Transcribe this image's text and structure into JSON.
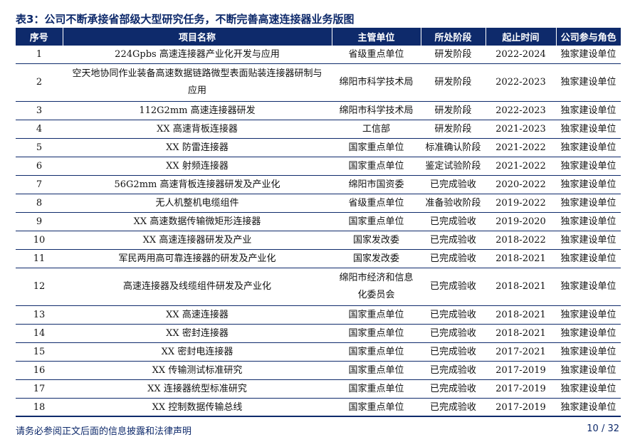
{
  "table_title": "表3：公司不断承接省部级大型研究任务，不断完善高速连接器业务版图",
  "columns": [
    "序号",
    "项目名称",
    "主管单位",
    "所处阶段",
    "起止时间",
    "公司参与角色"
  ],
  "rows": [
    {
      "no": "1",
      "name": "224Gpbs 高速连接器产业化开发与应用",
      "unit": "省级重点单位",
      "stage": "研发阶段",
      "period": "2022-2024",
      "role": "独家建设单位"
    },
    {
      "no": "2",
      "name": "空天地协同作业装备高速数据链路微型表面贴装连接器研制与应用",
      "unit": "绵阳市科学技术局",
      "stage": "研发阶段",
      "period": "2022-2023",
      "role": "独家建设单位"
    },
    {
      "no": "3",
      "name": "112G2mm 高速连接器研发",
      "unit": "绵阳市科学技术局",
      "stage": "研发阶段",
      "period": "2022-2023",
      "role": "独家建设单位"
    },
    {
      "no": "4",
      "name": "XX 高速背板连接器",
      "unit": "工信部",
      "stage": "研发阶段",
      "period": "2021-2023",
      "role": "独家建设单位"
    },
    {
      "no": "5",
      "name": "XX 防雷连接器",
      "unit": "国家重点单位",
      "stage": "标准确认阶段",
      "period": "2021-2022",
      "role": "独家建设单位"
    },
    {
      "no": "6",
      "name": "XX 射频连接器",
      "unit": "国家重点单位",
      "stage": "鉴定试验阶段",
      "period": "2021-2022",
      "role": "独家建设单位"
    },
    {
      "no": "7",
      "name": "56G2mm 高速背板连接器研发及产业化",
      "unit": "绵阳市国资委",
      "stage": "已完成验收",
      "period": "2020-2022",
      "role": "独家建设单位"
    },
    {
      "no": "8",
      "name": "无人机整机电缆组件",
      "unit": "省级重点单位",
      "stage": "准备验收阶段",
      "period": "2019-2022",
      "role": "独家建设单位"
    },
    {
      "no": "9",
      "name": "XX 高速数据传输微矩形连接器",
      "unit": "国家重点单位",
      "stage": "已完成验收",
      "period": "2019-2020",
      "role": "独家建设单位"
    },
    {
      "no": "10",
      "name": "XX 高速连接器研发及产业",
      "unit": "国家发改委",
      "stage": "已完成验收",
      "period": "2018-2022",
      "role": "独家建设单位"
    },
    {
      "no": "11",
      "name": "军民两用高可靠连接器的研发及产业化",
      "unit": "国家发改委",
      "stage": "已完成验收",
      "period": "2018-2021",
      "role": "独家建设单位"
    },
    {
      "no": "12",
      "name": "高速连接器及线缆组件研发及产业化",
      "unit": "绵阳市经济和信息化委员会",
      "stage": "已完成验收",
      "period": "2018-2021",
      "role": "独家建设单位"
    },
    {
      "no": "13",
      "name": "XX 高速连接器",
      "unit": "国家重点单位",
      "stage": "已完成验收",
      "period": "2018-2021",
      "role": "独家建设单位"
    },
    {
      "no": "14",
      "name": "XX 密封连接器",
      "unit": "国家重点单位",
      "stage": "已完成验收",
      "period": "2018-2021",
      "role": "独家建设单位"
    },
    {
      "no": "15",
      "name": "XX 密封电连接器",
      "unit": "国家重点单位",
      "stage": "已完成验收",
      "period": "2017-2021",
      "role": "独家建设单位"
    },
    {
      "no": "16",
      "name": "XX 传输测试标准研究",
      "unit": "国家重点单位",
      "stage": "已完成验收",
      "period": "2017-2019",
      "role": "独家建设单位"
    },
    {
      "no": "17",
      "name": "XX 连接器统型标准研究",
      "unit": "国家重点单位",
      "stage": "已完成验收",
      "period": "2017-2019",
      "role": "独家建设单位"
    },
    {
      "no": "18",
      "name": "XX 控制数据传输总线",
      "unit": "国家重点单位",
      "stage": "已完成验收",
      "period": "2017-2019",
      "role": "独家建设单位"
    }
  ],
  "footer": {
    "disclaimer": "请务必参阅正文后面的信息披露和法律声明",
    "page": "10 / 32"
  },
  "colors": {
    "header_bg": "#0e2a6b",
    "rule": "#0e2a6b",
    "title": "#0e2a6b"
  }
}
